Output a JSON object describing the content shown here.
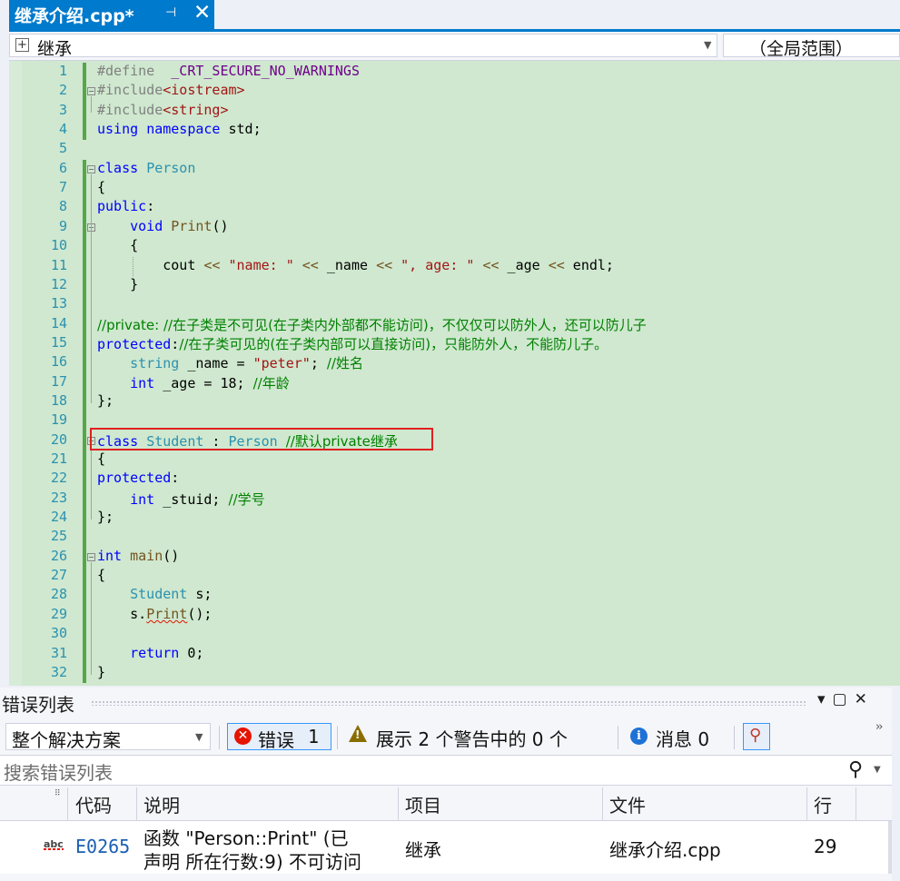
{
  "tab": {
    "title": "继承介绍.cpp*",
    "pin": "⊣",
    "close": "✕"
  },
  "navbar": {
    "scope": "继承",
    "global_scope": "（全局范围）"
  },
  "editor": {
    "line_numbers": [
      "1",
      "2",
      "3",
      "4",
      "5",
      "6",
      "7",
      "8",
      "9",
      "10",
      "11",
      "12",
      "13",
      "14",
      "15",
      "16",
      "17",
      "18",
      "19",
      "20",
      "21",
      "22",
      "23",
      "24",
      "25",
      "26",
      "27",
      "28",
      "29",
      "30",
      "31",
      "32"
    ],
    "lines": [
      [
        {
          "t": "#define",
          "c": "pp"
        },
        {
          "t": "  _CRT_SECURE_NO_WARNINGS",
          "c": "mac"
        }
      ],
      [
        {
          "t": "#include",
          "c": "pp"
        },
        {
          "t": "<iostream>",
          "c": "inc"
        }
      ],
      [
        {
          "t": "#include",
          "c": "pp"
        },
        {
          "t": "<string>",
          "c": "inc"
        }
      ],
      [
        {
          "t": "using",
          "c": "kw"
        },
        {
          "t": " "
        },
        {
          "t": "namespace",
          "c": "kw"
        },
        {
          "t": " std;"
        }
      ],
      [],
      [
        {
          "t": "class",
          "c": "kw"
        },
        {
          "t": " "
        },
        {
          "t": "Person",
          "c": "ty"
        }
      ],
      [
        {
          "t": "{"
        }
      ],
      [
        {
          "t": "public",
          "c": "kw"
        },
        {
          "t": ":"
        }
      ],
      [
        {
          "t": "    "
        },
        {
          "t": "void",
          "c": "kw"
        },
        {
          "t": " "
        },
        {
          "t": "Print",
          "c": "fn"
        },
        {
          "t": "()"
        }
      ],
      [
        {
          "t": "    {"
        }
      ],
      [
        {
          "t": "        cout "
        },
        {
          "t": "<<",
          "c": "fn"
        },
        {
          "t": " "
        },
        {
          "t": "\"name: \"",
          "c": "str"
        },
        {
          "t": " "
        },
        {
          "t": "<<",
          "c": "fn"
        },
        {
          "t": " _name "
        },
        {
          "t": "<<",
          "c": "fn"
        },
        {
          "t": " "
        },
        {
          "t": "\", age: \"",
          "c": "str"
        },
        {
          "t": " "
        },
        {
          "t": "<<",
          "c": "fn"
        },
        {
          "t": " _age "
        },
        {
          "t": "<<",
          "c": "fn"
        },
        {
          "t": " endl;"
        }
      ],
      [
        {
          "t": "    }"
        }
      ],
      [],
      [
        {
          "t": "//private: //在子类是不可见(在子类内外部都不能访问)，不仅仅可以防外人，还可以防儿子",
          "c": "cm"
        }
      ],
      [
        {
          "t": "protected",
          "c": "kw"
        },
        {
          "t": ":"
        },
        {
          "t": "//在子类可见的(在子类内部可以直接访问)，只能防外人，不能防儿子。",
          "c": "cm"
        }
      ],
      [
        {
          "t": "    "
        },
        {
          "t": "string",
          "c": "ty"
        },
        {
          "t": " _name = "
        },
        {
          "t": "\"peter\"",
          "c": "str"
        },
        {
          "t": "; "
        },
        {
          "t": "//姓名",
          "c": "cm"
        }
      ],
      [
        {
          "t": "    "
        },
        {
          "t": "int",
          "c": "kw"
        },
        {
          "t": " _age = 18; "
        },
        {
          "t": "//年龄",
          "c": "cm"
        }
      ],
      [
        {
          "t": "};"
        }
      ],
      [],
      [
        {
          "t": "class",
          "c": "kw"
        },
        {
          "t": " "
        },
        {
          "t": "Student",
          "c": "ty"
        },
        {
          "t": " : "
        },
        {
          "t": "Person",
          "c": "ty"
        },
        {
          "t": " "
        },
        {
          "t": "//默认private继承",
          "c": "cm"
        }
      ],
      [
        {
          "t": "{"
        }
      ],
      [
        {
          "t": "protected",
          "c": "kw"
        },
        {
          "t": ":"
        }
      ],
      [
        {
          "t": "    "
        },
        {
          "t": "int",
          "c": "kw"
        },
        {
          "t": " _stuid; "
        },
        {
          "t": "//学号",
          "c": "cm"
        }
      ],
      [
        {
          "t": "};"
        }
      ],
      [],
      [
        {
          "t": "int",
          "c": "kw"
        },
        {
          "t": " "
        },
        {
          "t": "main",
          "c": "fn"
        },
        {
          "t": "()"
        }
      ],
      [
        {
          "t": "{"
        }
      ],
      [
        {
          "t": "    "
        },
        {
          "t": "Student",
          "c": "ty"
        },
        {
          "t": " s;"
        }
      ],
      [
        {
          "t": "    s."
        },
        {
          "t": "Print",
          "c": "fn squig"
        },
        {
          "t": "();"
        }
      ],
      [],
      [
        {
          "t": "    "
        },
        {
          "t": "return",
          "c": "kw"
        },
        {
          "t": " 0;"
        }
      ],
      [
        {
          "t": "}"
        }
      ]
    ]
  },
  "error_list": {
    "title": "错误列表",
    "window_controls": "▾▢✕",
    "scope_select": "整个解决方案",
    "errors_label": "错误",
    "errors_count": "1",
    "warnings_label": "展示 2 个警告中的 0 个",
    "messages_label": "消息 0",
    "search_placeholder": "搜索错误列表",
    "columns": {
      "code": "代码",
      "description": "说明",
      "project": "项目",
      "file": "文件",
      "line": "行"
    },
    "rows": [
      {
        "code": "E0265",
        "description_line1": "函数 \"Person::Print\" (已",
        "description_line2": "声明 所在行数:9) 不可访问",
        "project": "继承",
        "file": "继承介绍.cpp",
        "line": "29"
      }
    ]
  },
  "colors": {
    "accent": "#007acc",
    "editor_background": "#cfe8cf",
    "highlight_box": "#e02020",
    "keyword": "#0000ff",
    "type": "#2b91af",
    "string": "#a31515",
    "comment": "#008000"
  }
}
